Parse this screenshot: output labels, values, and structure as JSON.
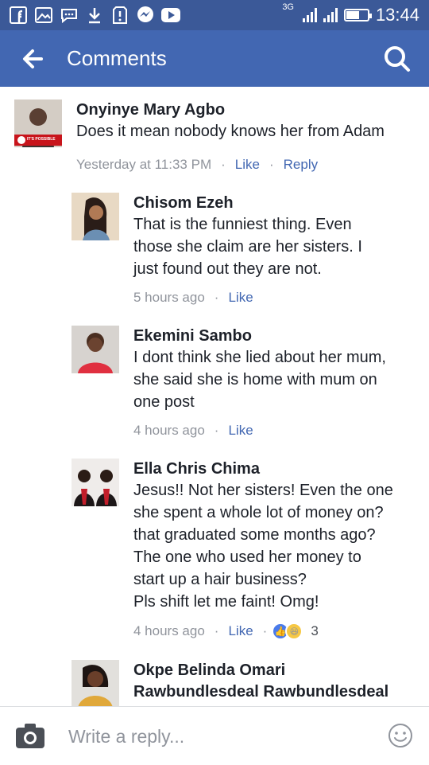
{
  "status_bar": {
    "network": "3G",
    "time": "13:44",
    "notification_icons": [
      "facebook-icon",
      "gallery-icon",
      "messages-icon",
      "download-icon",
      "alert-icon",
      "messenger-icon",
      "youtube-icon"
    ]
  },
  "header": {
    "title": "Comments",
    "back_icon": "arrow-left-icon",
    "search_icon": "search-icon"
  },
  "colors": {
    "statusbar": "#3b5998",
    "appbar": "#4267b2",
    "meta_text": "#90949c",
    "link": "#4267b2"
  },
  "comments": [
    {
      "author": "Onyinye Mary Agbo",
      "text": "Does it mean nobody knows her from Adam",
      "time": "Yesterday at 11:33 PM",
      "like": "Like",
      "reply": "Reply",
      "avatar_badge": "IT'S POSSIBLE"
    },
    {
      "author": "Chisom Ezeh",
      "text": "That is the funniest thing. Even\nthose she claim are her sisters. I\njust found out they are not.",
      "time": "5 hours ago",
      "like": "Like"
    },
    {
      "author": "Ekemini Sambo",
      "text": "I dont think she lied about her mum,\nshe said she is home with mum on\none post",
      "time": "4 hours ago",
      "like": "Like"
    },
    {
      "author": "Ella Chris Chima",
      "text": "Jesus!! Not her sisters! Even the one\nshe spent a whole lot of money on?\nthat graduated some months ago?\nThe one who used her money to\nstart up a hair business?\nPls shift let me faint! Omg!",
      "time": "4 hours ago",
      "like": "Like",
      "reactions": [
        "like",
        "haha"
      ],
      "reaction_count": "3"
    },
    {
      "author": "Okpe Belinda Omari",
      "text": "Rawbundlesdeal Rawbundlesdeal"
    }
  ],
  "reply_bar": {
    "placeholder": "Write a reply...",
    "camera_icon": "camera-icon",
    "emoji_icon": "emoji-icon"
  }
}
